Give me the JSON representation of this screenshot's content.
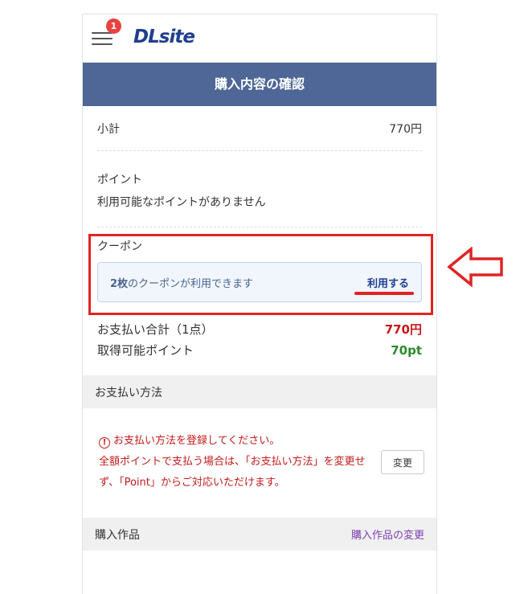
{
  "header": {
    "logo_text": "DLsite",
    "notification_count": "1"
  },
  "page_title": "購入内容の確認",
  "subtotal": {
    "label": "小計",
    "value": "770円"
  },
  "points": {
    "label": "ポイント",
    "message": "利用可能なポイントがありません"
  },
  "coupon": {
    "label": "クーポン",
    "count_text": "2枚",
    "available_text": "のクーポンが利用できます",
    "use_link": "利用する"
  },
  "totals": {
    "payment_label": "お支払い合計（1点）",
    "payment_value": "770円",
    "points_label": "取得可能ポイント",
    "points_value": "70pt"
  },
  "payment_method": {
    "heading": "お支払い方法",
    "warning_icon": "exclamation-circle-icon",
    "message_line1": "お支払い方法を登録してください。",
    "message_line2": "全額ポイントで支払う場合は、「お支払い方法」を変更せず、「Point」からご対応いただけます。",
    "change_button": "変更"
  },
  "purchased_items": {
    "heading": "購入作品",
    "change_link": "購入作品の変更"
  },
  "colors": {
    "title_bar": "#4e6797",
    "accent_red": "#c31a1a",
    "points_green": "#2b8b2b",
    "annotation_red": "#e02424",
    "link_purple": "#7d3fb1"
  }
}
